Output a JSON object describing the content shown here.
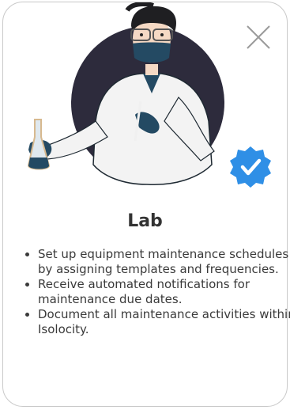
{
  "dialog": {
    "title": "Lab",
    "close_icon": "close-x-icon",
    "illustration_icon": "lab-scientist-illustration",
    "badge_icon": "verified-check-badge-icon",
    "features": [
      "Set up equipment maintenance schedules by assigning templates and frequencies.",
      "Receive automated notifications for maintenance due dates.",
      "Document all maintenance activities within Isolocity."
    ]
  },
  "colors": {
    "border": "#c9c9c9",
    "circle": "#2d2b3c",
    "badge": "#2f8fe6",
    "mask": "#244a63",
    "text": "#333333"
  }
}
